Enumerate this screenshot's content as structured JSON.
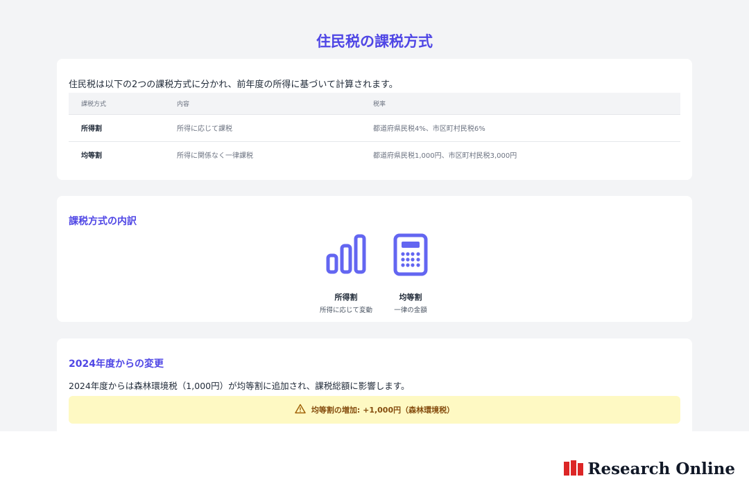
{
  "title": "住民税の課税方式",
  "overview": {
    "intro": "住民税は以下の2つの課税方式に分かれ、前年度の所得に基づいて計算されます。",
    "table": {
      "headers": [
        "課税方式",
        "内容",
        "税率"
      ],
      "rows": [
        [
          "所得割",
          "所得に応じて課税",
          "都道府県民税4%、市区町村民税6%"
        ],
        [
          "均等割",
          "所得に関係なく一律課税",
          "都道府県民税1,000円、市区町村民税3,000円"
        ]
      ]
    }
  },
  "breakdown": {
    "heading": "課税方式の内訳",
    "items": [
      {
        "icon": "bar-chart-icon",
        "label": "所得割",
        "sub": "所得に応じて変動"
      },
      {
        "icon": "calculator-icon",
        "label": "均等割",
        "sub": "一律の金額"
      }
    ]
  },
  "changes": {
    "heading": "2024年度からの変更",
    "text": "2024年度からは森林環境税（1,000円）が均等割に追加され、課税総額に影響します。",
    "warning": "均等割の増加: +1,000円（森林環境税）"
  },
  "logo": {
    "text": "Research Online"
  },
  "colors": {
    "accent": "#4f46e5",
    "icon": "#6366f1",
    "warning_bg": "#fef9c3",
    "warning_text": "#854d0e"
  }
}
